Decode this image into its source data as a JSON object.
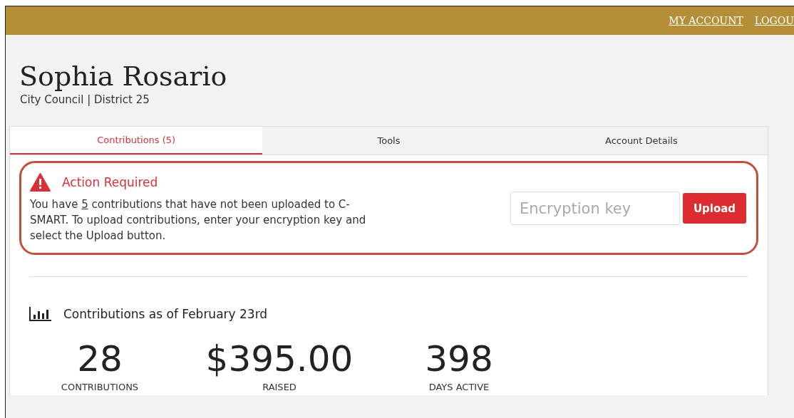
{
  "header": {
    "links": [
      {
        "label": "MY ACCOUNT"
      },
      {
        "label": "LOGOU"
      }
    ]
  },
  "profile": {
    "name": "Sophia Rosario",
    "subtitle": "City Council | District 25"
  },
  "tabs": [
    {
      "label": "Contributions (5)",
      "selected": true
    },
    {
      "label": "Tools",
      "selected": false
    },
    {
      "label": "Account Details",
      "selected": false
    }
  ],
  "alert": {
    "title": "Action Required",
    "message": {
      "before": "You have ",
      "count": "5",
      "after": " contributions that have not been uploaded to C-SMART. To upload contributions, enter your encryption key and select the Upload button."
    },
    "field": {
      "placeholder": "Encryption key"
    },
    "button": "Upload"
  },
  "summary": {
    "heading": "Contributions as of February 23rd",
    "stats": [
      {
        "value": "28",
        "label": "CONTRIBUTIONS"
      },
      {
        "value": "$395.00",
        "label": "RAISED"
      },
      {
        "value": "398",
        "label": "DAYS ACTIVE"
      }
    ]
  }
}
